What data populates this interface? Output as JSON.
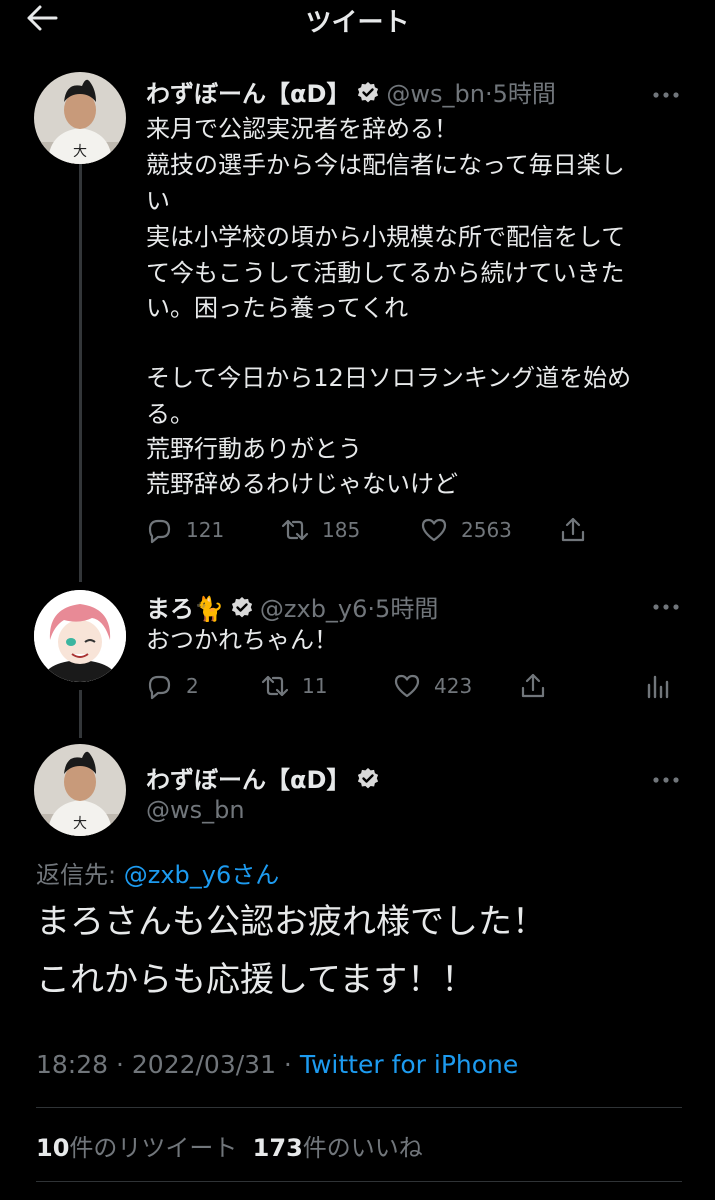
{
  "header": {
    "title": "ツイート"
  },
  "tweet1": {
    "name": "わずぼーん【αD】",
    "handle": "@ws_bn",
    "time": "5時間",
    "lines": [
      "来月で公認実況者を辞める！",
      "競技の選手から今は配信者になって毎日楽し",
      "い",
      "実は小学校の頃から小規模な所で配信をして",
      "て今もこうして活動してるから続けていきた",
      "い。困ったら養ってくれ",
      "",
      "そして今日から12日ソロランキング道を始め",
      "る。",
      "荒野行動ありがとう",
      "荒野辞めるわけじゃないけど"
    ],
    "replies": "121",
    "retweets": "185",
    "likes": "2563"
  },
  "tweet2": {
    "name": "まろ🐈",
    "handle": "@zxb_y6",
    "time": "5時間",
    "text": "おつかれちゃん！",
    "replies": "2",
    "retweets": "11",
    "likes": "423"
  },
  "main": {
    "name": "わずぼーん【αD】",
    "handle": "@ws_bn",
    "reply_label": "返信先: ",
    "reply_to": "@zxb_y6さん",
    "lines": [
      "まろさんも公認お疲れ様でした！",
      "これからも応援してます！！"
    ],
    "timestamp": "18:28 · 2022/03/31 · ",
    "client": "Twitter for iPhone",
    "retweet_count": "10",
    "retweet_label": "件のリツイート",
    "like_count": "173",
    "like_label": "件のいいね"
  },
  "colors": {
    "accent": "#1d9bf0",
    "muted": "#71767b",
    "text": "#e7e9ea",
    "background": "#000000"
  }
}
